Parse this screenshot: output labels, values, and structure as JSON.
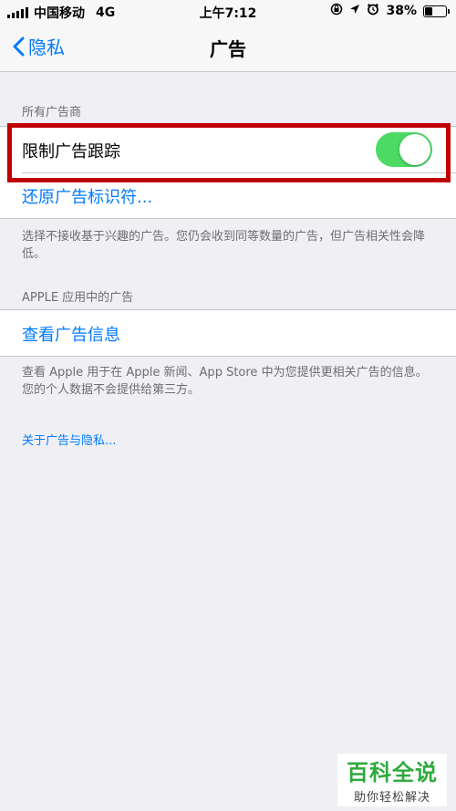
{
  "status_bar": {
    "carrier": "中国移动",
    "network": "4G",
    "time": "上午7:12",
    "battery_percent": "38%",
    "battery_level": 0.38
  },
  "nav": {
    "back_label": "隐私",
    "title": "广告"
  },
  "advertisers_section": {
    "header": "所有广告商",
    "limit_tracking_label": "限制广告跟踪",
    "limit_tracking_on": true,
    "reset_identifier_label": "还原广告标识符...",
    "footer": "选择不接收基于兴趣的广告。您仍会收到同等数量的广告，但广告相关性会降低。"
  },
  "apple_section": {
    "header": "APPLE 应用中的广告",
    "view_info_label": "查看广告信息",
    "footer": "查看 Apple 用于在 Apple 新闻、App Store 中为您提供更相关广告的信息。您的个人数据不会提供给第三方。"
  },
  "about_link": "关于广告与隐私...",
  "watermark": {
    "title": "百科全说",
    "subtitle": "助你轻松解决"
  },
  "colors": {
    "accent": "#007aff",
    "toggle_on": "#4cd964",
    "highlight": "#c00000"
  }
}
